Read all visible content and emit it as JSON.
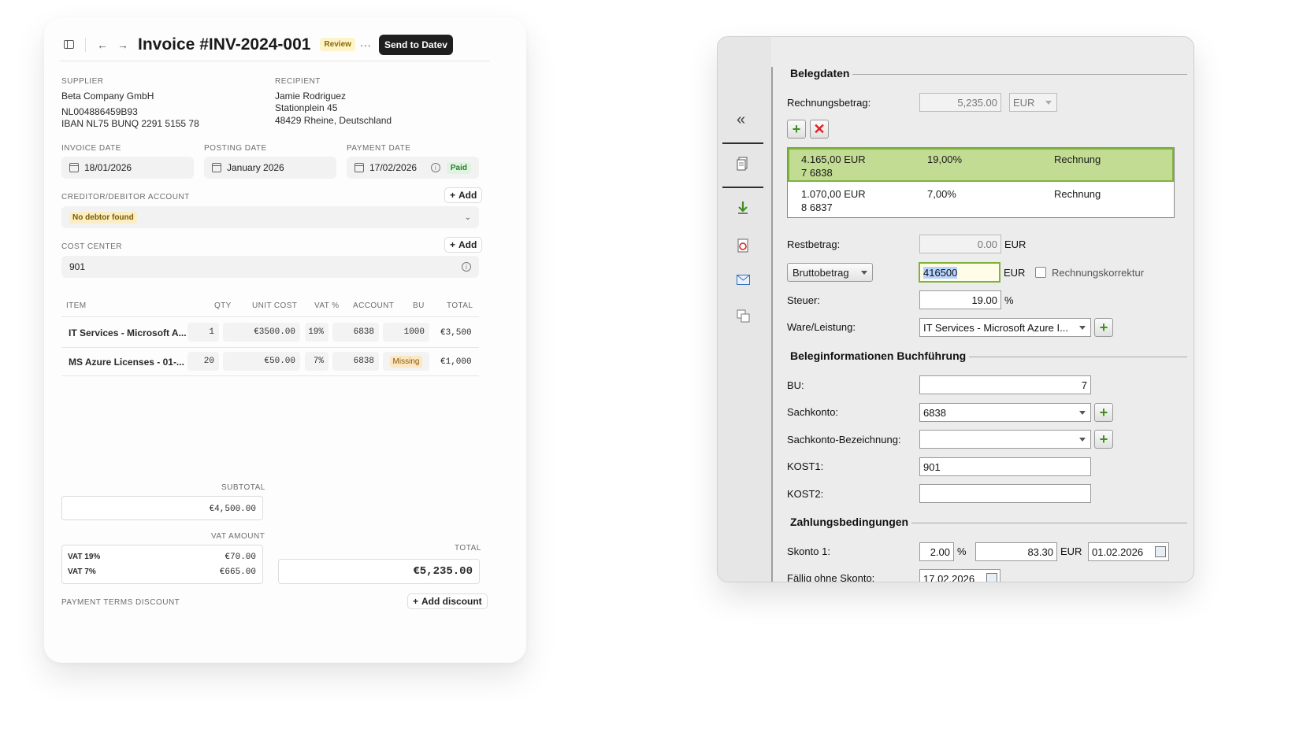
{
  "invoice": {
    "title": "Invoice #INV-2024-001",
    "status_badge": "Review",
    "more_label": "···",
    "send_button": "Send to Datev",
    "supplier": {
      "label": "SUPPLIER",
      "name": "Beta Company GmbH",
      "vat_id": "NL004886459B93",
      "iban": "IBAN NL75 BUNQ 2291 5155 78"
    },
    "recipient": {
      "label": "RECIPIENT",
      "name": "Jamie Rodriguez",
      "street": "Stationplein 45",
      "city": "48429 Rheine, Deutschland"
    },
    "invoice_date": {
      "label": "INVOICE DATE",
      "value": "18/01/2026"
    },
    "posting_date": {
      "label": "POSTING DATE",
      "value": "January 2026"
    },
    "payment_date": {
      "label": "PAYMENT DATE",
      "value": "17/02/2026",
      "badge": "Paid"
    },
    "creditor": {
      "label": "CREDITOR/DEBITOR ACCOUNT",
      "add_label": "Add",
      "value": "No debtor found"
    },
    "cost_center": {
      "label": "COST CENTER",
      "add_label": "Add",
      "value": "901"
    },
    "table": {
      "headers": [
        "ITEM",
        "QTY",
        "UNIT COST",
        "VAT %",
        "ACCOUNT",
        "BU",
        "TOTAL"
      ],
      "rows": [
        {
          "item": "IT Services - Microsoft A...",
          "qty": "1",
          "unit_cost": "€3500.00",
          "vat": "19%",
          "account": "6838",
          "bu": "1000",
          "total": "€3,500"
        },
        {
          "item": "MS Azure Licenses - 01-...",
          "qty": "20",
          "unit_cost": "€50.00",
          "vat": "7%",
          "account": "6838",
          "bu": "Missing",
          "total": "€1,000"
        }
      ]
    },
    "subtotal": {
      "label": "SUBTOTAL",
      "value": "€4,500.00"
    },
    "vat_amount": {
      "label": "VAT AMOUNT",
      "lines": [
        {
          "label": "VAT 19%",
          "value": "€70.00"
        },
        {
          "label": "VAT 7%",
          "value": "€665.00"
        }
      ]
    },
    "total": {
      "label": "TOTAL",
      "value": "€5,235.00"
    },
    "payment_terms": {
      "label": "PAYMENT TERMS DISCOUNT",
      "add_label": "Add discount"
    }
  },
  "datev": {
    "belegdaten": "Belegdaten",
    "rechnungsbetrag": {
      "label": "Rechnungsbetrag:",
      "value": "5,235.00",
      "currency": "EUR"
    },
    "splits": [
      {
        "amount": "4.165,00 EUR",
        "account": "7 6838",
        "rate": "19,00%",
        "type": "Rechnung",
        "selected": true
      },
      {
        "amount": "1.070,00 EUR",
        "account": "8 6837",
        "rate": "7,00%",
        "type": "Rechnung",
        "selected": false
      }
    ],
    "restbetrag": {
      "label": "Restbetrag:",
      "value": "0.00",
      "currency": "EUR"
    },
    "brutto": {
      "dropdown": "Bruttobetrag",
      "value": "416500",
      "currency": "EUR",
      "checkbox_label": "Rechnungskorrektur"
    },
    "steuer": {
      "label": "Steuer:",
      "value": "19.00",
      "unit": "%"
    },
    "ware": {
      "label": "Ware/Leistung:",
      "value": "IT Services - Microsoft Azure I..."
    },
    "buchfuehrung": "Beleginformationen Buchführung",
    "bu": {
      "label": "BU:",
      "value": "7"
    },
    "sachkonto": {
      "label": "Sachkonto:",
      "value": "6838"
    },
    "sachkonto_bez": {
      "label": "Sachkonto-Bezeichnung:",
      "value": ""
    },
    "kost1": {
      "label": "KOST1:",
      "value": "901"
    },
    "kost2": {
      "label": "KOST2:",
      "value": ""
    },
    "zahlungsbedingungen": "Zahlungsbedingungen",
    "skonto1": {
      "label": "Skonto 1:",
      "percent": "2.00",
      "percent_unit": "%",
      "amount": "83.30",
      "currency": "EUR",
      "date": "01.02.2026"
    },
    "faellig": {
      "label": "Fällig ohne Skonto:",
      "date": "17.02.2026"
    }
  }
}
